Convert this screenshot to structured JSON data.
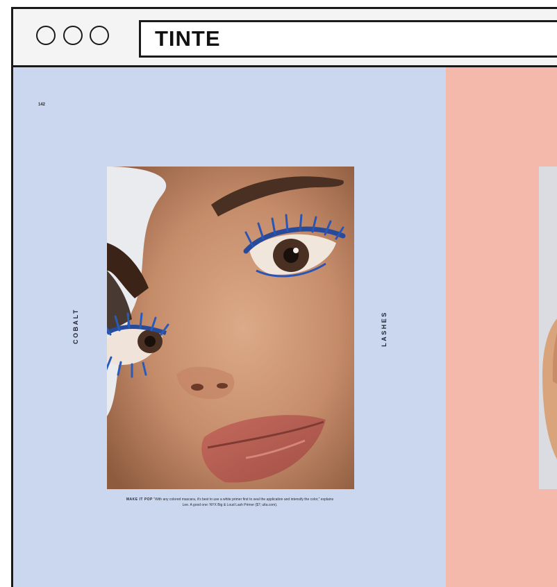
{
  "tab": {
    "title": "TINTE"
  },
  "page": {
    "number": "142",
    "label_left": "COBALT",
    "label_right": "LASHES",
    "caption_lead": "MAKE IT POP",
    "caption_body": "\"With any colored mascara, it's best to use a white primer first to seal the application and intensify the color,\" explains Lee. A good one: NYX Big & Loud Lash Primer ($7; ulta.com)."
  },
  "colors": {
    "page_left_bg": "#cad7ef",
    "page_right_bg": "#f4b9aa",
    "ink": "#1a1a1a"
  }
}
